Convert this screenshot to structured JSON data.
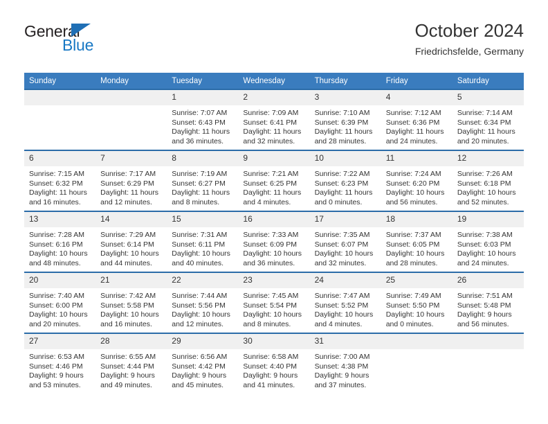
{
  "brand": {
    "name_top": "General",
    "name_bottom": "Blue",
    "accent_color": "#1878c4",
    "triangle_color": "#1f6fb5"
  },
  "header": {
    "title": "October 2024",
    "subtitle": "Friedrichsfelde, Germany"
  },
  "theme": {
    "header_bg": "#3a7cbe",
    "row_border": "#2b6ca8",
    "daynum_bg": "#f0f0f0",
    "text": "#333333"
  },
  "weekdays": [
    "Sunday",
    "Monday",
    "Tuesday",
    "Wednesday",
    "Thursday",
    "Friday",
    "Saturday"
  ],
  "labels": {
    "sunrise_prefix": "Sunrise: ",
    "sunset_prefix": "Sunset: ",
    "daylight_prefix": "Daylight: "
  },
  "weeks": [
    [
      {
        "day": ""
      },
      {
        "day": ""
      },
      {
        "day": "1",
        "sunrise": "Sunrise: 7:07 AM",
        "sunset": "Sunset: 6:43 PM",
        "daylight_l1": "Daylight: 11 hours",
        "daylight_l2": "and 36 minutes."
      },
      {
        "day": "2",
        "sunrise": "Sunrise: 7:09 AM",
        "sunset": "Sunset: 6:41 PM",
        "daylight_l1": "Daylight: 11 hours",
        "daylight_l2": "and 32 minutes."
      },
      {
        "day": "3",
        "sunrise": "Sunrise: 7:10 AM",
        "sunset": "Sunset: 6:39 PM",
        "daylight_l1": "Daylight: 11 hours",
        "daylight_l2": "and 28 minutes."
      },
      {
        "day": "4",
        "sunrise": "Sunrise: 7:12 AM",
        "sunset": "Sunset: 6:36 PM",
        "daylight_l1": "Daylight: 11 hours",
        "daylight_l2": "and 24 minutes."
      },
      {
        "day": "5",
        "sunrise": "Sunrise: 7:14 AM",
        "sunset": "Sunset: 6:34 PM",
        "daylight_l1": "Daylight: 11 hours",
        "daylight_l2": "and 20 minutes."
      }
    ],
    [
      {
        "day": "6",
        "sunrise": "Sunrise: 7:15 AM",
        "sunset": "Sunset: 6:32 PM",
        "daylight_l1": "Daylight: 11 hours",
        "daylight_l2": "and 16 minutes."
      },
      {
        "day": "7",
        "sunrise": "Sunrise: 7:17 AM",
        "sunset": "Sunset: 6:29 PM",
        "daylight_l1": "Daylight: 11 hours",
        "daylight_l2": "and 12 minutes."
      },
      {
        "day": "8",
        "sunrise": "Sunrise: 7:19 AM",
        "sunset": "Sunset: 6:27 PM",
        "daylight_l1": "Daylight: 11 hours",
        "daylight_l2": "and 8 minutes."
      },
      {
        "day": "9",
        "sunrise": "Sunrise: 7:21 AM",
        "sunset": "Sunset: 6:25 PM",
        "daylight_l1": "Daylight: 11 hours",
        "daylight_l2": "and 4 minutes."
      },
      {
        "day": "10",
        "sunrise": "Sunrise: 7:22 AM",
        "sunset": "Sunset: 6:23 PM",
        "daylight_l1": "Daylight: 11 hours",
        "daylight_l2": "and 0 minutes."
      },
      {
        "day": "11",
        "sunrise": "Sunrise: 7:24 AM",
        "sunset": "Sunset: 6:20 PM",
        "daylight_l1": "Daylight: 10 hours",
        "daylight_l2": "and 56 minutes."
      },
      {
        "day": "12",
        "sunrise": "Sunrise: 7:26 AM",
        "sunset": "Sunset: 6:18 PM",
        "daylight_l1": "Daylight: 10 hours",
        "daylight_l2": "and 52 minutes."
      }
    ],
    [
      {
        "day": "13",
        "sunrise": "Sunrise: 7:28 AM",
        "sunset": "Sunset: 6:16 PM",
        "daylight_l1": "Daylight: 10 hours",
        "daylight_l2": "and 48 minutes."
      },
      {
        "day": "14",
        "sunrise": "Sunrise: 7:29 AM",
        "sunset": "Sunset: 6:14 PM",
        "daylight_l1": "Daylight: 10 hours",
        "daylight_l2": "and 44 minutes."
      },
      {
        "day": "15",
        "sunrise": "Sunrise: 7:31 AM",
        "sunset": "Sunset: 6:11 PM",
        "daylight_l1": "Daylight: 10 hours",
        "daylight_l2": "and 40 minutes."
      },
      {
        "day": "16",
        "sunrise": "Sunrise: 7:33 AM",
        "sunset": "Sunset: 6:09 PM",
        "daylight_l1": "Daylight: 10 hours",
        "daylight_l2": "and 36 minutes."
      },
      {
        "day": "17",
        "sunrise": "Sunrise: 7:35 AM",
        "sunset": "Sunset: 6:07 PM",
        "daylight_l1": "Daylight: 10 hours",
        "daylight_l2": "and 32 minutes."
      },
      {
        "day": "18",
        "sunrise": "Sunrise: 7:37 AM",
        "sunset": "Sunset: 6:05 PM",
        "daylight_l1": "Daylight: 10 hours",
        "daylight_l2": "and 28 minutes."
      },
      {
        "day": "19",
        "sunrise": "Sunrise: 7:38 AM",
        "sunset": "Sunset: 6:03 PM",
        "daylight_l1": "Daylight: 10 hours",
        "daylight_l2": "and 24 minutes."
      }
    ],
    [
      {
        "day": "20",
        "sunrise": "Sunrise: 7:40 AM",
        "sunset": "Sunset: 6:00 PM",
        "daylight_l1": "Daylight: 10 hours",
        "daylight_l2": "and 20 minutes."
      },
      {
        "day": "21",
        "sunrise": "Sunrise: 7:42 AM",
        "sunset": "Sunset: 5:58 PM",
        "daylight_l1": "Daylight: 10 hours",
        "daylight_l2": "and 16 minutes."
      },
      {
        "day": "22",
        "sunrise": "Sunrise: 7:44 AM",
        "sunset": "Sunset: 5:56 PM",
        "daylight_l1": "Daylight: 10 hours",
        "daylight_l2": "and 12 minutes."
      },
      {
        "day": "23",
        "sunrise": "Sunrise: 7:45 AM",
        "sunset": "Sunset: 5:54 PM",
        "daylight_l1": "Daylight: 10 hours",
        "daylight_l2": "and 8 minutes."
      },
      {
        "day": "24",
        "sunrise": "Sunrise: 7:47 AM",
        "sunset": "Sunset: 5:52 PM",
        "daylight_l1": "Daylight: 10 hours",
        "daylight_l2": "and 4 minutes."
      },
      {
        "day": "25",
        "sunrise": "Sunrise: 7:49 AM",
        "sunset": "Sunset: 5:50 PM",
        "daylight_l1": "Daylight: 10 hours",
        "daylight_l2": "and 0 minutes."
      },
      {
        "day": "26",
        "sunrise": "Sunrise: 7:51 AM",
        "sunset": "Sunset: 5:48 PM",
        "daylight_l1": "Daylight: 9 hours",
        "daylight_l2": "and 56 minutes."
      }
    ],
    [
      {
        "day": "27",
        "sunrise": "Sunrise: 6:53 AM",
        "sunset": "Sunset: 4:46 PM",
        "daylight_l1": "Daylight: 9 hours",
        "daylight_l2": "and 53 minutes."
      },
      {
        "day": "28",
        "sunrise": "Sunrise: 6:55 AM",
        "sunset": "Sunset: 4:44 PM",
        "daylight_l1": "Daylight: 9 hours",
        "daylight_l2": "and 49 minutes."
      },
      {
        "day": "29",
        "sunrise": "Sunrise: 6:56 AM",
        "sunset": "Sunset: 4:42 PM",
        "daylight_l1": "Daylight: 9 hours",
        "daylight_l2": "and 45 minutes."
      },
      {
        "day": "30",
        "sunrise": "Sunrise: 6:58 AM",
        "sunset": "Sunset: 4:40 PM",
        "daylight_l1": "Daylight: 9 hours",
        "daylight_l2": "and 41 minutes."
      },
      {
        "day": "31",
        "sunrise": "Sunrise: 7:00 AM",
        "sunset": "Sunset: 4:38 PM",
        "daylight_l1": "Daylight: 9 hours",
        "daylight_l2": "and 37 minutes."
      },
      {
        "day": ""
      },
      {
        "day": ""
      }
    ]
  ]
}
